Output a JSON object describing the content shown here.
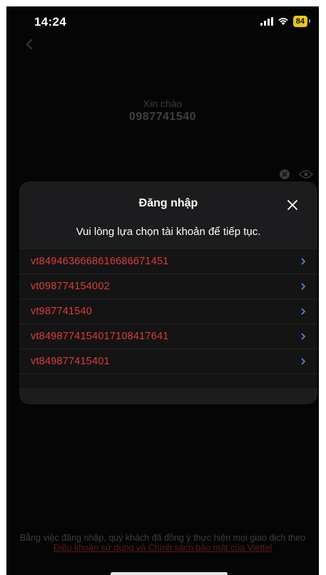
{
  "status_bar": {
    "time": "14:24",
    "battery": "84"
  },
  "background": {
    "greeting": "Xin chào",
    "phone_number": "0987741540"
  },
  "sheet": {
    "title": "Đăng nhập",
    "subtitle": "Vui lòng lựa chọn tài khoản để tiếp tục.",
    "accounts": [
      {
        "label": "vt84946366686166866714 51"
      },
      {
        "label": "vt098774154002"
      },
      {
        "label": "vt987741540"
      },
      {
        "label": "vt8498774154017108417641"
      },
      {
        "label": "vt849877415401"
      }
    ]
  },
  "footer": {
    "text": "Bằng việc đăng nhập, quý khách đã đồng ý thực hiện mọi giao dịch theo",
    "link": "Điều khoản sử dụng và Chính sách bảo mật của Viettel"
  },
  "colors": {
    "accent": "#e03a3a",
    "battery": "#e8c51e",
    "sheet": "#1c1c1e"
  }
}
